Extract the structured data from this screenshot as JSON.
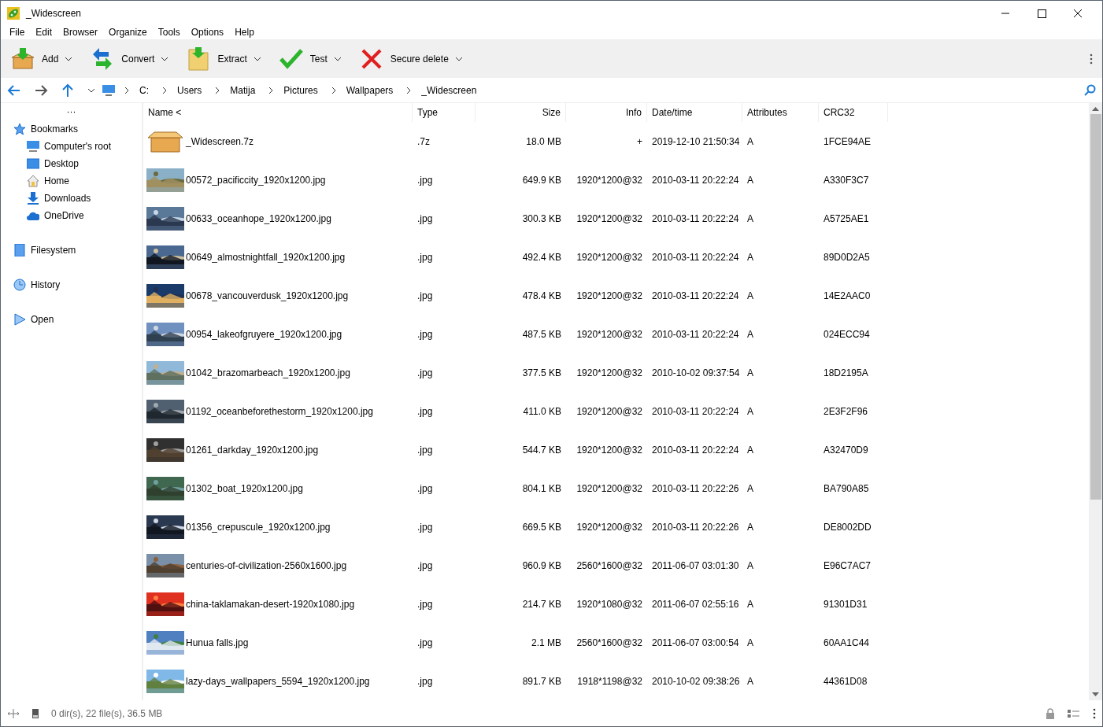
{
  "window": {
    "title": "_Widescreen"
  },
  "menu": [
    "File",
    "Edit",
    "Browser",
    "Organize",
    "Tools",
    "Options",
    "Help"
  ],
  "toolbar": [
    {
      "label": "Add",
      "kind": "add"
    },
    {
      "label": "Convert",
      "kind": "convert"
    },
    {
      "label": "Extract",
      "kind": "extract"
    },
    {
      "label": "Test",
      "kind": "test"
    },
    {
      "label": "Secure delete",
      "kind": "delete"
    }
  ],
  "breadcrumb": [
    "C:",
    "Users",
    "Matija",
    "Pictures",
    "Wallpapers",
    "_Widescreen"
  ],
  "sidebar": {
    "more": "···",
    "sections": [
      {
        "label": "Bookmarks",
        "kind": "bookmarks",
        "children": [
          {
            "label": "Computer's root",
            "kind": "computer"
          },
          {
            "label": "Desktop",
            "kind": "desktop"
          },
          {
            "label": "Home",
            "kind": "home"
          },
          {
            "label": "Downloads",
            "kind": "downloads"
          },
          {
            "label": "OneDrive",
            "kind": "cloud"
          }
        ]
      },
      {
        "label": "Filesystem",
        "kind": "filesystem"
      },
      {
        "label": "History",
        "kind": "history"
      },
      {
        "label": "Open",
        "kind": "open"
      }
    ]
  },
  "table": {
    "columns": [
      "Name <",
      "Type",
      "Size",
      "Info",
      "Date/time",
      "Attributes",
      "CRC32"
    ],
    "rows": [
      {
        "kind": "archive",
        "cells": [
          "_Widescreen.7z",
          ".7z",
          "18.0 MB",
          "+",
          "2019-12-10 21:50:34",
          "A",
          "1FCE94AE"
        ]
      },
      {
        "kind": "picture",
        "cells": [
          "00572_pacificcity_1920x1200.jpg",
          ".jpg",
          "649.9 KB",
          "1920*1200@32",
          "2010-03-11 20:22:24",
          "A",
          "A330F3C7"
        ]
      },
      {
        "kind": "picture",
        "cells": [
          "00633_oceanhope_1920x1200.jpg",
          ".jpg",
          "300.3 KB",
          "1920*1200@32",
          "2010-03-11 20:22:24",
          "A",
          "A5725AE1"
        ]
      },
      {
        "kind": "picture",
        "cells": [
          "00649_almostnightfall_1920x1200.jpg",
          ".jpg",
          "492.4 KB",
          "1920*1200@32",
          "2010-03-11 20:22:24",
          "A",
          "89D0D2A5"
        ]
      },
      {
        "kind": "picture",
        "cells": [
          "00678_vancouverdusk_1920x1200.jpg",
          ".jpg",
          "478.4 KB",
          "1920*1200@32",
          "2010-03-11 20:22:24",
          "A",
          "14E2AAC0"
        ]
      },
      {
        "kind": "picture",
        "cells": [
          "00954_lakeofgruyere_1920x1200.jpg",
          ".jpg",
          "487.5 KB",
          "1920*1200@32",
          "2010-03-11 20:22:24",
          "A",
          "024ECC94"
        ]
      },
      {
        "kind": "picture",
        "cells": [
          "01042_brazomarbeach_1920x1200.jpg",
          ".jpg",
          "377.5 KB",
          "1920*1200@32",
          "2010-10-02 09:37:54",
          "A",
          "18D2195A"
        ]
      },
      {
        "kind": "picture",
        "cells": [
          "01192_oceanbeforethestorm_1920x1200.jpg",
          ".jpg",
          "411.0 KB",
          "1920*1200@32",
          "2010-03-11 20:22:24",
          "A",
          "2E3F2F96"
        ]
      },
      {
        "kind": "picture",
        "cells": [
          "01261_darkday_1920x1200.jpg",
          ".jpg",
          "544.7 KB",
          "1920*1200@32",
          "2010-03-11 20:22:24",
          "A",
          "A32470D9"
        ]
      },
      {
        "kind": "picture",
        "cells": [
          "01302_boat_1920x1200.jpg",
          ".jpg",
          "804.1 KB",
          "1920*1200@32",
          "2010-03-11 20:22:26",
          "A",
          "BA790A85"
        ]
      },
      {
        "kind": "picture",
        "cells": [
          "01356_crepuscule_1920x1200.jpg",
          ".jpg",
          "669.5 KB",
          "1920*1200@32",
          "2010-03-11 20:22:26",
          "A",
          "DE8002DD"
        ]
      },
      {
        "kind": "picture",
        "cells": [
          "centuries-of-civilization-2560x1600.jpg",
          ".jpg",
          "960.9 KB",
          "2560*1600@32",
          "2011-06-07 03:01:30",
          "A",
          "E96C7AC7"
        ]
      },
      {
        "kind": "picture",
        "cells": [
          "china-taklamakan-desert-1920x1080.jpg",
          ".jpg",
          "214.7 KB",
          "1920*1080@32",
          "2011-06-07 02:55:16",
          "A",
          "91301D31"
        ]
      },
      {
        "kind": "picture",
        "cells": [
          "Hunua falls.jpg",
          ".jpg",
          "2.1 MB",
          "2560*1600@32",
          "2011-06-07 03:00:54",
          "A",
          "60AA1C44"
        ]
      },
      {
        "kind": "picture",
        "cells": [
          "lazy-days_wallpapers_5594_1920x1200.jpg",
          ".jpg",
          "891.7 KB",
          "1918*1198@32",
          "2010-10-02 09:38:26",
          "A",
          "44361D08"
        ]
      }
    ]
  },
  "status_bar": {
    "text": "0 dir(s), 22 file(s), 36.5 MB"
  }
}
